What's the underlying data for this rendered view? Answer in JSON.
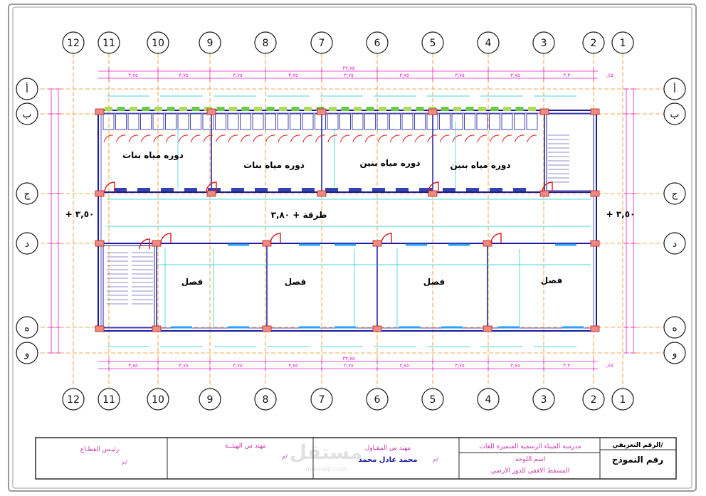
{
  "grid_top": [
    "12",
    "11",
    "10",
    "9",
    "8",
    "7",
    "6",
    "5",
    "4",
    "3",
    "2",
    "1"
  ],
  "grid_bottom": [
    "12",
    "11",
    "10",
    "9",
    "8",
    "7",
    "6",
    "5",
    "4",
    "3",
    "2",
    "1"
  ],
  "rows_right": [
    "أ",
    "ب",
    "ج",
    "د",
    "ه",
    "و"
  ],
  "rows_left": [
    "أ",
    "ب",
    "ج",
    "د",
    "ه",
    "و"
  ],
  "rooms": {
    "wc_girls_1": "دوره مياه بنات",
    "wc_girls_2": "دوره مياه بنات",
    "wc_boys_1": "دوره مياه بنين",
    "wc_boys_2": "دوره مياه بنين",
    "corridor": "طرقة + ٣,٨٠",
    "class_1": "فصل",
    "class_2": "فصل",
    "class_3": "فصل",
    "class_4": "فصل"
  },
  "levels": {
    "left": "+ ٣,٥٠",
    "right": "+ ٣,٥٠"
  },
  "dims": {
    "total": "٣٣,٧٥",
    "bay": "٣,٧٥",
    "bay_end": "٣,٣٠",
    "edge": "٠,٤٥"
  },
  "title_block": {
    "sector_head": "رئيـس القطـاع",
    "sector_head_sign": "م/",
    "engineering_eng": "مهند س الهيئــة",
    "engineering_sign": "م/",
    "contractor_eng": "مهند س المقـاول",
    "contractor_name": "محمد عادل محمد",
    "contractor_sign": "م/",
    "school_name": "مدرسة الميناء الرسمية المتميزة للغات",
    "drawing_name_label": "اسم اللوحة",
    "drawing_name": "المسقط الافقي للدور الارضي",
    "ref_no": "الرقم التعريفي/",
    "model_no": "رقم النموذج"
  },
  "watermark": "مستقل",
  "watermark_sub": "mostaql.com"
}
